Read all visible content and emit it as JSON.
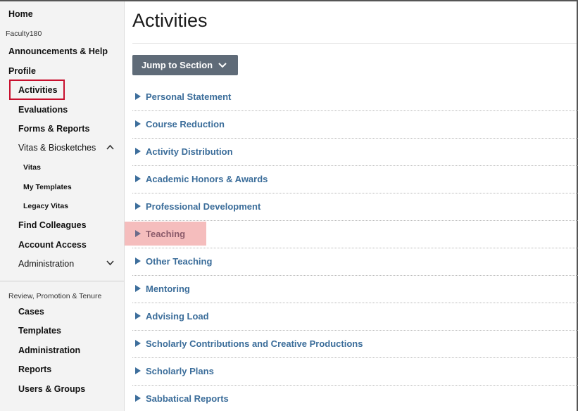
{
  "sidebar": {
    "home": "Home",
    "faculty_section": "Faculty180",
    "items": [
      {
        "label": "Announcements & Help"
      },
      {
        "label": "Profile"
      },
      {
        "label": "Activities"
      },
      {
        "label": "Evaluations"
      },
      {
        "label": "Forms & Reports"
      },
      {
        "label": "Vitas & Biosketches"
      },
      {
        "label": "Vitas"
      },
      {
        "label": "My Templates"
      },
      {
        "label": "Legacy Vitas"
      },
      {
        "label": "Find Colleagues"
      },
      {
        "label": "Account Access"
      },
      {
        "label": "Administration"
      }
    ],
    "rpt_section": "Review, Promotion & Tenure",
    "rpt_items": [
      {
        "label": "Cases"
      },
      {
        "label": "Templates"
      },
      {
        "label": "Administration"
      },
      {
        "label": "Reports"
      },
      {
        "label": "Users & Groups"
      }
    ],
    "active_item": "Activities",
    "active_outline_color": "#c8102e"
  },
  "main": {
    "title": "Activities",
    "jump_label": "Jump to Section",
    "sections": [
      {
        "label": "Personal Statement"
      },
      {
        "label": "Course Reduction"
      },
      {
        "label": "Activity Distribution"
      },
      {
        "label": "Academic Honors & Awards"
      },
      {
        "label": "Professional Development"
      },
      {
        "label": "Teaching",
        "highlighted": true
      },
      {
        "label": "Other Teaching"
      },
      {
        "label": "Mentoring"
      },
      {
        "label": "Advising Load"
      },
      {
        "label": "Scholarly Contributions and Creative Productions"
      },
      {
        "label": "Scholarly Plans"
      },
      {
        "label": "Sabbatical Reports"
      }
    ],
    "link_color": "#3b6d9a",
    "highlight_color": "#f4b9b9"
  }
}
